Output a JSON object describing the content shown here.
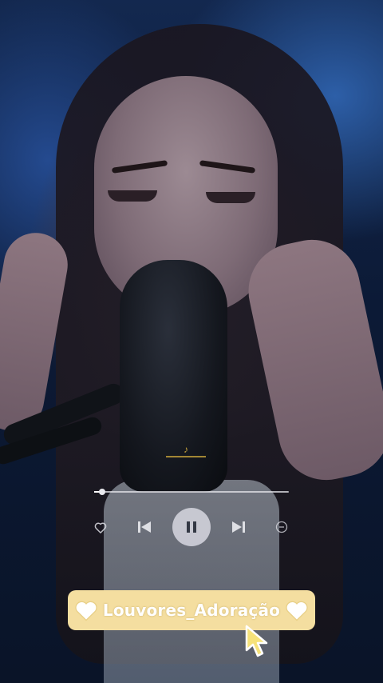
{
  "player": {
    "progress": 0.04,
    "controls": {
      "like": "heart-outline-icon",
      "previous": "skip-previous-icon",
      "play_pause": "pause-icon",
      "next": "skip-next-icon",
      "more": "minus-circle-icon"
    }
  },
  "channel": {
    "name": "Louvores_Adoração",
    "left_icon": "heart-icon",
    "right_icon": "heart-icon"
  },
  "colors": {
    "pill_background": "#f4dea0",
    "pill_text": "#ffffff",
    "cursor_fill": "#f6e27a"
  }
}
